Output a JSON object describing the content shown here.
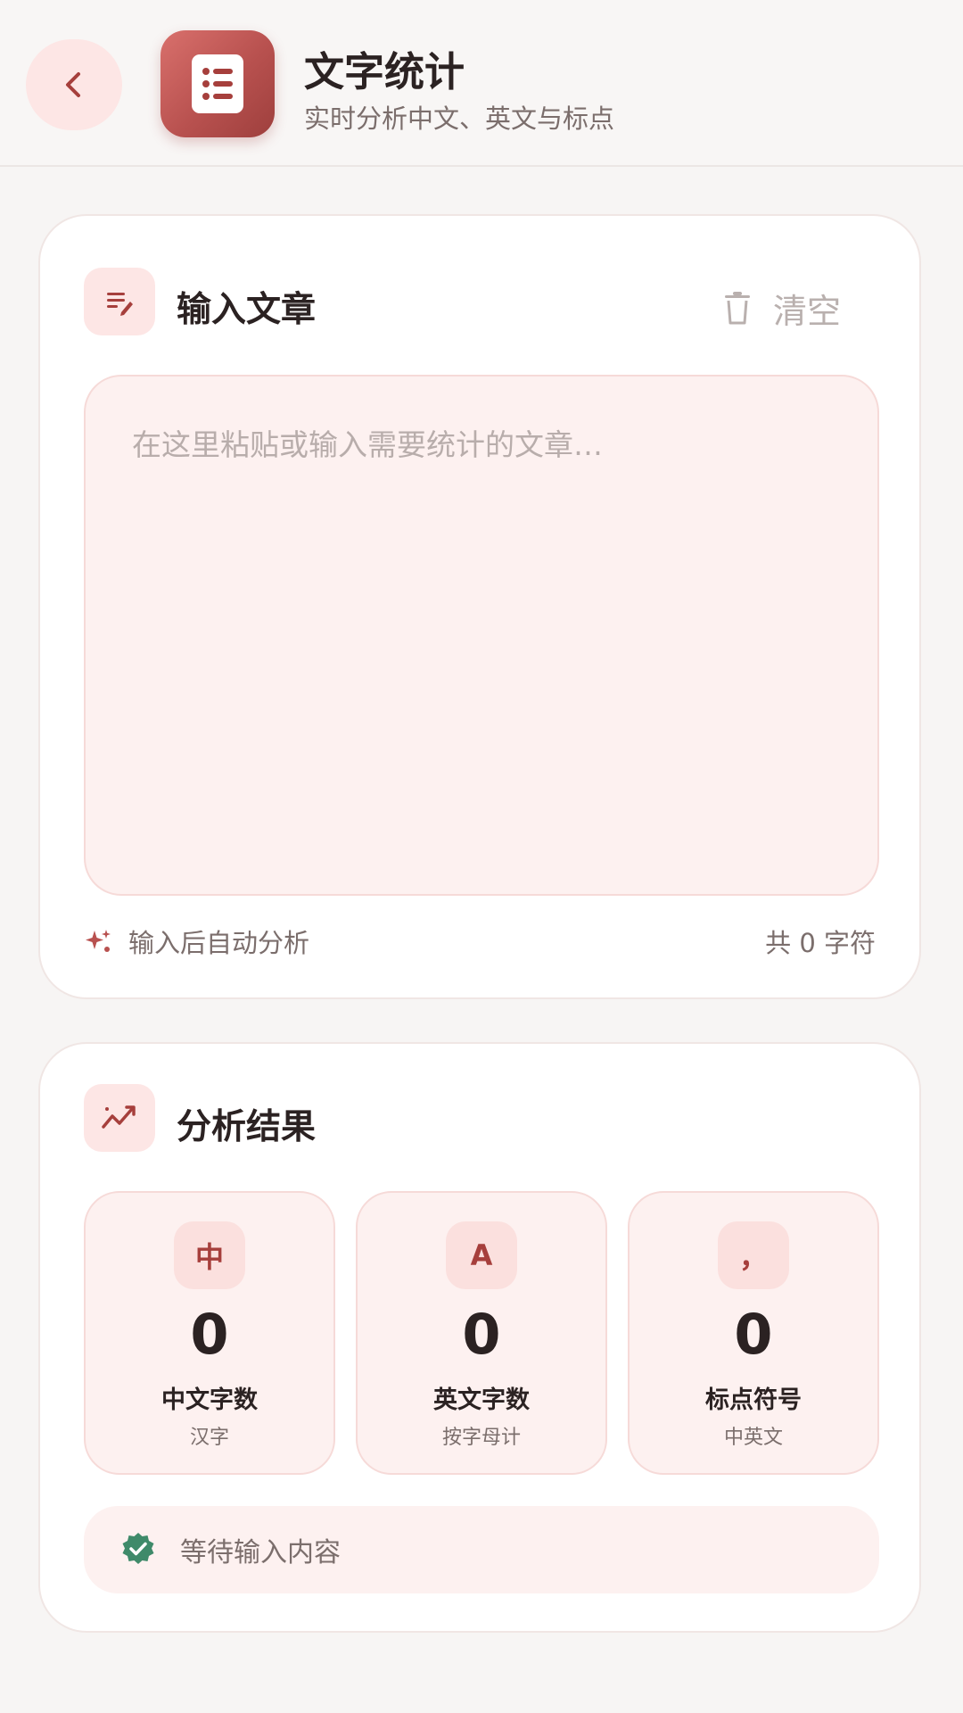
{
  "header": {
    "title": "文字统计",
    "subtitle": "实时分析中文、英文与标点"
  },
  "input_card": {
    "title": "输入文章",
    "clear_label": "清空",
    "placeholder": "在这里粘贴或输入需要统计的文章…",
    "hint": "输入后自动分析",
    "count_text": "共 0 字符"
  },
  "result_card": {
    "title": "分析结果",
    "stats": [
      {
        "badge": "中",
        "value": "0",
        "label": "中文字数",
        "sub": "汉字"
      },
      {
        "badge": "A",
        "value": "0",
        "label": "英文字数",
        "sub": "按字母计"
      },
      {
        "badge": "，",
        "value": "0",
        "label": "标点符号",
        "sub": "中英文"
      }
    ],
    "status": "等待输入内容"
  },
  "colors": {
    "accent": "#b8514f",
    "accent_light": "#fde6e5",
    "status_ok": "#3f8a6a"
  },
  "icons": {
    "back": "chevron-left-icon",
    "app": "document-list-icon",
    "edit": "text-edit-icon",
    "trash": "trash-icon",
    "sparkle": "sparkle-icon",
    "chart": "trend-chart-icon",
    "check": "verified-check-icon"
  }
}
